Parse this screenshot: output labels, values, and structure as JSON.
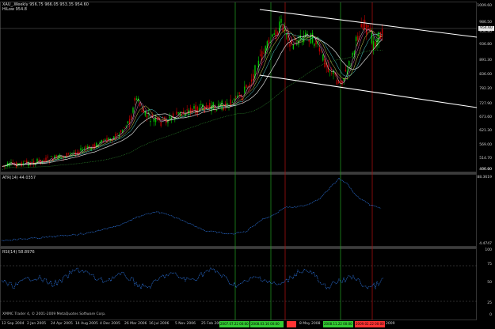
{
  "header": {
    "symbol_line": "XAU_,Weekly  956.75 966.05 953.35 954.60",
    "sub_line": "HiLow 954.8"
  },
  "price_axis": {
    "labels": [
      "1009.60",
      "986.50",
      "956.80",
      "936.80",
      "891.30",
      "836.00",
      "782.20",
      "727.90",
      "673.60",
      "621.30",
      "569.00",
      "514.70",
      "460.40",
      "406.00",
      "356.00"
    ],
    "current_price_box": "954.60"
  },
  "atr": {
    "label": "ATR(14) 44.0357",
    "axis_top": "88.3619",
    "axis_bottom": "4.4747"
  },
  "rsi": {
    "label": "RSI(14) 58.8976",
    "axis_labels": [
      "100",
      "75",
      "50",
      "25",
      "0"
    ]
  },
  "time_axis": {
    "labels": [
      "12 Sep 2004",
      "2 Jan 2005",
      "24 Apr 2005",
      "14 Aug 2005",
      "4 Dec 2005",
      "26 Mar 2006",
      "16 Jul 2006",
      "5 Nov 2006",
      "25 Feb 2007",
      "",
      "",
      "",
      "8 May 2008",
      "",
      "",
      "2009"
    ],
    "highlighted": [
      {
        "text": "2007.07.22 00:00",
        "color": "#33cc33"
      },
      {
        "text": "2008.03.16 00:00",
        "color": "#33cc33"
      },
      {
        "text": "",
        "color": "#ff3333"
      },
      {
        "text": "2008.11.22 00:00",
        "color": "#33cc33"
      },
      {
        "text": "2009.02.22 00:00",
        "color": "#ff3333"
      }
    ]
  },
  "footer": {
    "copyright": "XMMC Trader 4, © 2001-2009 MetaQuotes Software Corp."
  },
  "colors": {
    "background": "#000000",
    "candle_up": "#00c000",
    "candle_down": "#c00000",
    "channel": "#ffffff",
    "indicator_line": "#2a6fd6",
    "vline_green": "#1f8f1f",
    "vline_red": "#a01010"
  }
}
